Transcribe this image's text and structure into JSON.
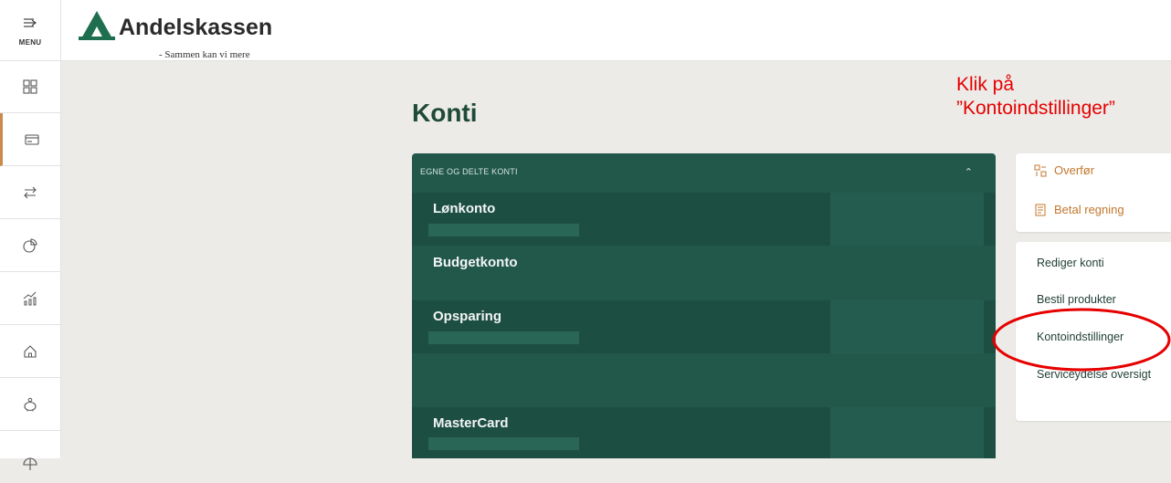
{
  "header": {
    "brand_name": "Andelskassen",
    "tagline": "- Sammen kan vi mere"
  },
  "sidebar": {
    "menu_label": "MENU",
    "items": [
      {
        "icon": "dashboard-icon",
        "active": false
      },
      {
        "icon": "card-icon",
        "active": true
      },
      {
        "icon": "transfer-icon",
        "active": false
      },
      {
        "icon": "pie-chart-icon",
        "active": false
      },
      {
        "icon": "investment-chart-icon",
        "active": false
      },
      {
        "icon": "home-icon",
        "active": false
      },
      {
        "icon": "piggy-bank-icon",
        "active": false
      },
      {
        "icon": "umbrella-icon",
        "active": false
      }
    ]
  },
  "main": {
    "title": "Konti",
    "accounts_section": {
      "header": "EGNE OG DELTE KONTI",
      "accounts": [
        {
          "name": "Lønkonto"
        },
        {
          "name": "Budgetkonto"
        },
        {
          "name": "Opsparing"
        },
        {
          "name": "MasterCard"
        }
      ]
    }
  },
  "quick_actions": {
    "transfer": "Overfør",
    "pay_bill": "Betal regning"
  },
  "account_links": {
    "edit_accounts": "Rediger konti",
    "order_products": "Bestil produkter",
    "account_settings": "Kontoindstillinger",
    "service_overview": "Serviceydelse oversigt"
  },
  "annotation": {
    "line1": "Klik på",
    "line2": "”Kontoindstillinger”"
  },
  "colors": {
    "brand_green": "#21584a",
    "accent_orange": "#c2772e",
    "annotation_red": "#e60000"
  }
}
